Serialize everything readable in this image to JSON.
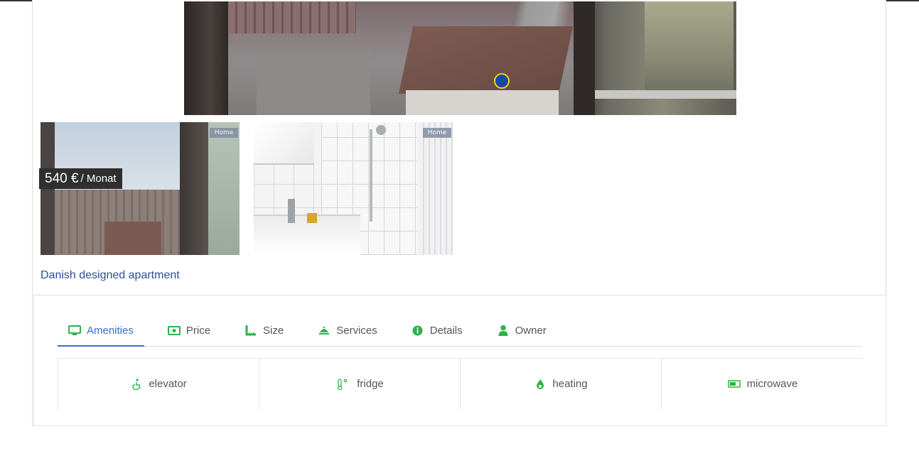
{
  "listing": {
    "price": "540 €",
    "per": "/ Monat",
    "title": "Danish designed apartment",
    "watermark": "Home"
  },
  "tabs": [
    {
      "label": "Amenities",
      "icon": "monitor-icon",
      "active": true
    },
    {
      "label": "Price",
      "icon": "money-icon",
      "active": false
    },
    {
      "label": "Size",
      "icon": "ruler-icon",
      "active": false
    },
    {
      "label": "Services",
      "icon": "bell-icon",
      "active": false
    },
    {
      "label": "Details",
      "icon": "info-icon",
      "active": false
    },
    {
      "label": "Owner",
      "icon": "user-icon",
      "active": false
    }
  ],
  "amenities": [
    {
      "label": "elevator",
      "icon": "accessibility-icon"
    },
    {
      "label": "fridge",
      "icon": "thermometer-icon"
    },
    {
      "label": "heating",
      "icon": "flame-icon"
    },
    {
      "label": "microwave",
      "icon": "microwave-icon"
    }
  ],
  "colors": {
    "accent": "#3d6bce",
    "icon_green": "#2db34a",
    "link": "#2f4f93"
  }
}
